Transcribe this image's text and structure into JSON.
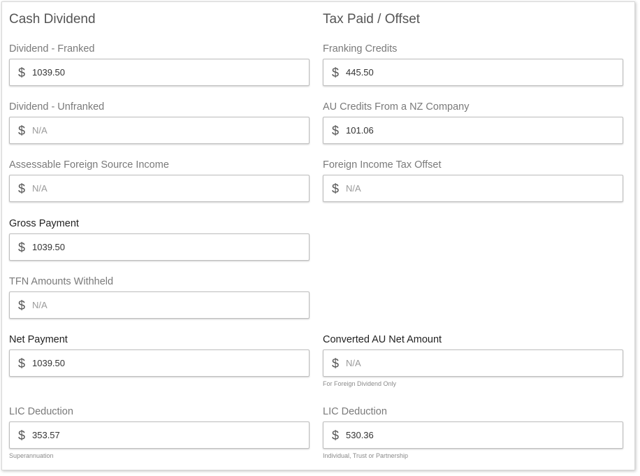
{
  "cash_dividend": {
    "title": "Cash Dividend",
    "fields": [
      {
        "label": "Dividend - Franked",
        "currency": "$",
        "value": "1039.50"
      },
      {
        "label": "Dividend - Unfranked",
        "currency": "$",
        "placeholder": "N/A"
      },
      {
        "label": "Assessable Foreign Source Income",
        "currency": "$",
        "placeholder": "N/A"
      },
      {
        "label": "Gross Payment",
        "currency": "$",
        "value": "1039.50"
      },
      {
        "label": "TFN Amounts Withheld",
        "currency": "$",
        "placeholder": "N/A"
      },
      {
        "label": "Net Payment",
        "currency": "$",
        "value": "1039.50"
      },
      {
        "label": "LIC Deduction",
        "currency": "$",
        "value": "353.57",
        "hint": "Superannuation"
      }
    ]
  },
  "tax_paid_offset": {
    "title": "Tax Paid / Offset",
    "fields": [
      {
        "label": "Franking Credits",
        "currency": "$",
        "value": "445.50"
      },
      {
        "label": "AU Credits From a NZ Company",
        "currency": "$",
        "value": "101.06"
      },
      {
        "label": "Foreign Income Tax Offset",
        "currency": "$",
        "placeholder": "N/A"
      },
      {
        "label": "Converted AU Net Amount",
        "currency": "$",
        "placeholder": "N/A",
        "hint": "For Foreign Dividend Only"
      },
      {
        "label": "LIC Deduction",
        "currency": "$",
        "value": "530.36",
        "hint": "Individual, Trust or Partnership"
      }
    ]
  }
}
